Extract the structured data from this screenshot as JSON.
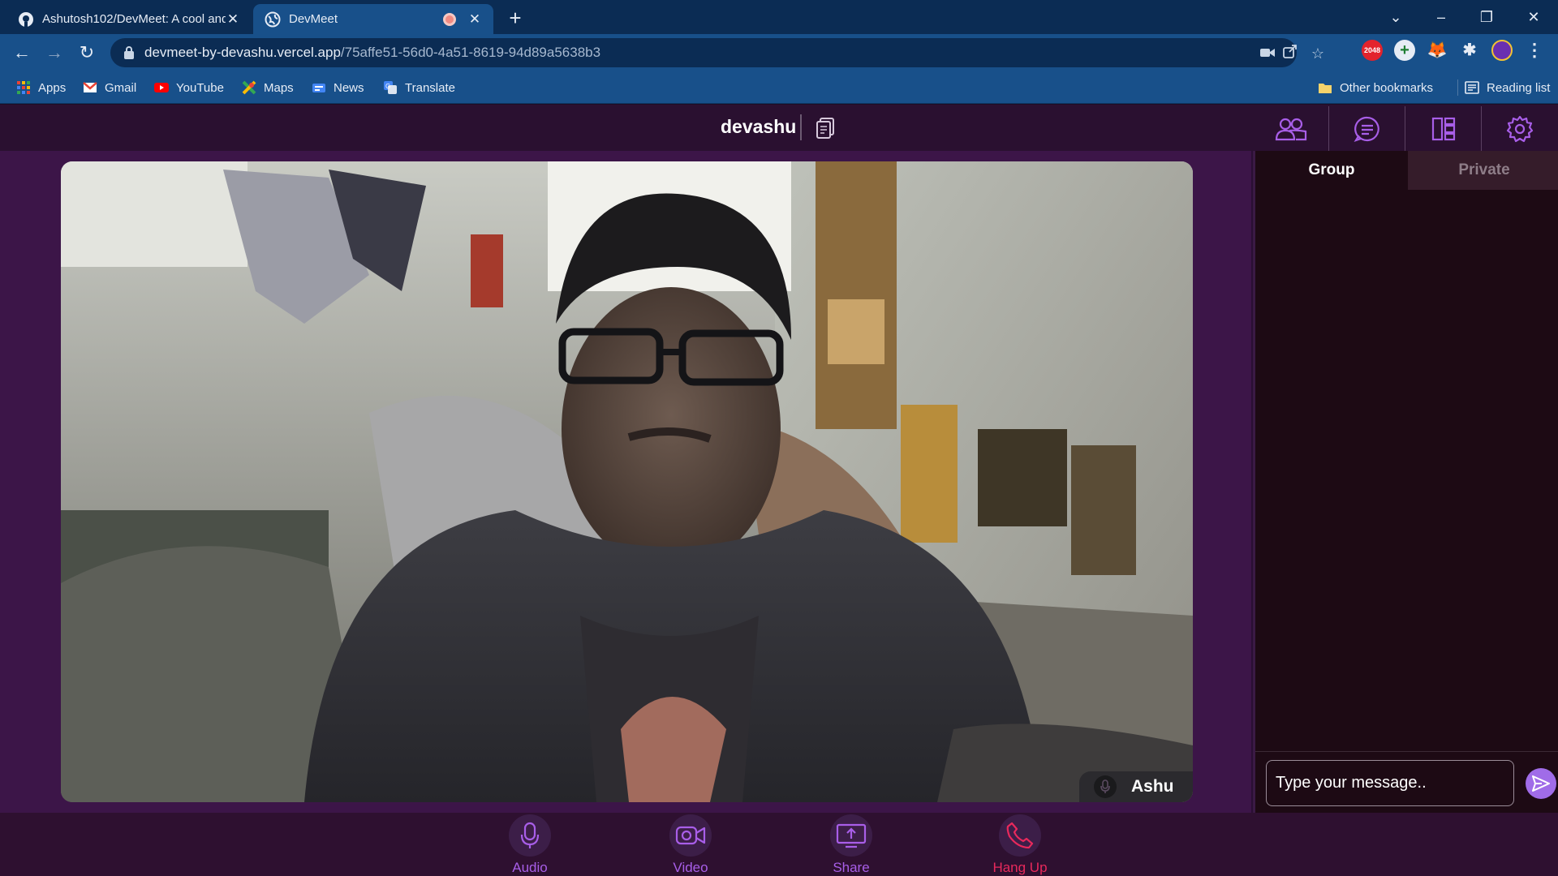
{
  "browser": {
    "tabs": [
      {
        "title": "Ashutosh102/DevMeet: A cool and",
        "close": "✕"
      },
      {
        "title": "DevMeet",
        "close": "✕"
      }
    ],
    "new_tab": "+",
    "window_controls": {
      "tab_search": "⌄",
      "minimize": "–",
      "restore": "❐",
      "close": "✕"
    },
    "nav": {
      "back": "←",
      "forward": "→",
      "reload": "↻"
    },
    "url_host": "devmeet-by-devashu.vercel.app",
    "url_path": "/75affe51-56d0-4a51-8619-94d89a5638b3",
    "bookmarks": [
      "Apps",
      "Gmail",
      "YouTube",
      "Maps",
      "News",
      "Translate"
    ],
    "other_bookmarks": "Other bookmarks",
    "reading_list": "Reading list",
    "accent": "#18508a"
  },
  "app": {
    "room_name": "devashu",
    "participant_name": "Ashu",
    "sidebar": {
      "tabs": [
        "Group",
        "Private"
      ],
      "active_tab": "Group",
      "message_placeholder": "Type your message.."
    },
    "controls": [
      {
        "label": "Audio",
        "icon": "mic-icon"
      },
      {
        "label": "Video",
        "icon": "camera-icon"
      },
      {
        "label": "Share",
        "icon": "screen-share-icon"
      },
      {
        "label": "Hang Up",
        "icon": "phone-icon"
      }
    ],
    "colors": {
      "accent": "#a85ee8",
      "hangup": "#e8295c",
      "send": "#a06ce8"
    }
  }
}
